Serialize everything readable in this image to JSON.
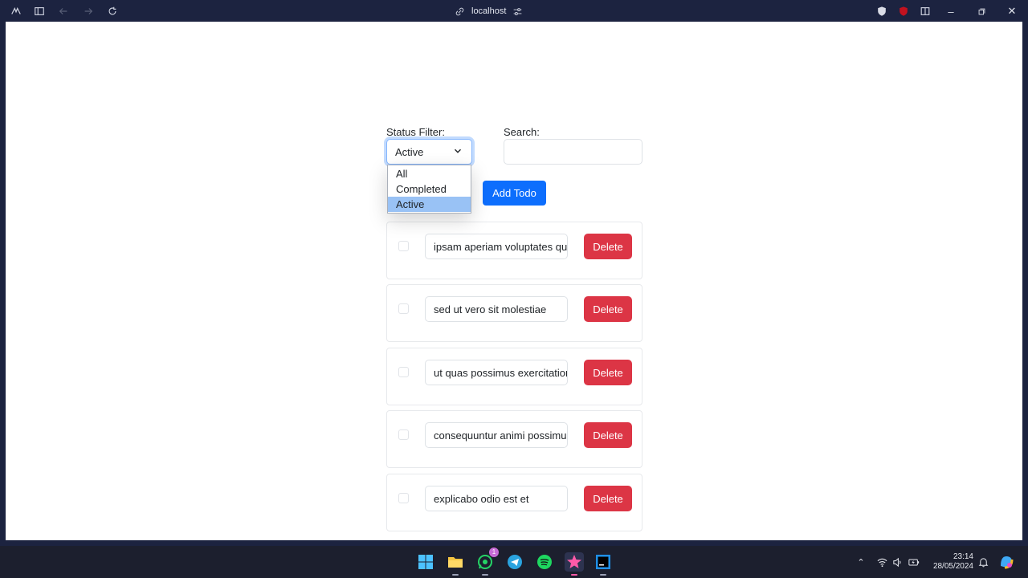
{
  "browser": {
    "address": "localhost"
  },
  "filter": {
    "status_label": "Status Filter:",
    "selected": "Active",
    "options": [
      "All",
      "Completed",
      "Active"
    ],
    "search_label": "Search:",
    "search_value": ""
  },
  "add_button_label": "Add Todo",
  "todos": [
    {
      "text": "ipsam aperiam voluptates qui",
      "delete_label": "Delete"
    },
    {
      "text": "sed ut vero sit molestiae",
      "delete_label": "Delete"
    },
    {
      "text": "ut quas possimus exercitationem",
      "delete_label": "Delete"
    },
    {
      "text": "consequuntur animi possimus",
      "delete_label": "Delete"
    },
    {
      "text": "explicabo odio est et",
      "delete_label": "Delete"
    }
  ],
  "taskbar": {
    "whatsapp_badge": "1",
    "time": "23:14",
    "date": "28/05/2024"
  },
  "colors": {
    "primary": "#0d6efd",
    "danger": "#dc3545",
    "chrome": "#1c2340"
  }
}
